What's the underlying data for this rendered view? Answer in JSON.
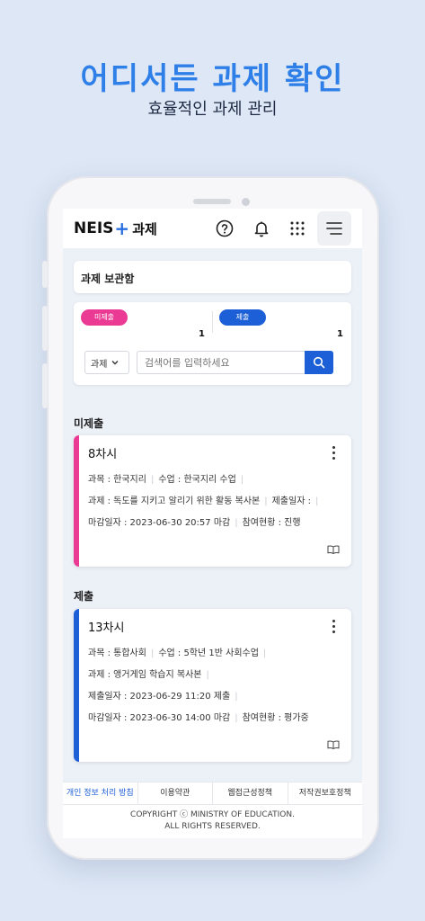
{
  "promo": {
    "title": "어디서든 과제 확인",
    "subtitle": "효율적인 과제 관리"
  },
  "app": {
    "logo_text": "NEIS",
    "logo_plus": "+",
    "logo_sub": "과제",
    "icons": [
      "help-circle-icon",
      "bell-icon",
      "grid-icon",
      "hamburger-icon"
    ]
  },
  "box": {
    "title": "과제 보관함"
  },
  "stats": {
    "unsubmitted_label": "미제출",
    "unsubmitted_count": "1",
    "submitted_label": "제출",
    "submitted_count": "1"
  },
  "search": {
    "select_value": "과제",
    "placeholder": "검색어를 입력하세요"
  },
  "sections": {
    "unsubmitted": "미제출",
    "submitted": "제출"
  },
  "cards": [
    {
      "title": "8차시",
      "subject": "과목 : 한국지리",
      "class": "수업 : 한국지리 수업",
      "task": "과제 : 독도를 지키고 알리기 위한 활동 복사본",
      "submit_date": "제출일자 :",
      "deadline": "마감일자 : 2023-06-30 20:57 마감",
      "status": "참여현황 : 진행",
      "accent": "#ea3a93"
    },
    {
      "title": "13차시",
      "subject": "과목 : 통합사회",
      "class": "수업 : 5학년 1반 사회수업",
      "task": "과제 : 앵거게임 학습지 복사본",
      "submit_date": "제출일자 : 2023-06-29 11:20 제출",
      "deadline": "마감일자 : 2023-06-30 14:00 마감",
      "status": "참여현황 : 평가중",
      "accent": "#1d5fd6"
    }
  ],
  "footer": {
    "links": [
      "개인 정보 처리 방침",
      "이용약관",
      "웹접근성정책",
      "저작권보호정책"
    ],
    "copyright_line1": "COPYRIGHT ⓒ MINISTRY OF EDUCATION.",
    "copyright_line2": "ALL RIGHTS RESERVED."
  }
}
